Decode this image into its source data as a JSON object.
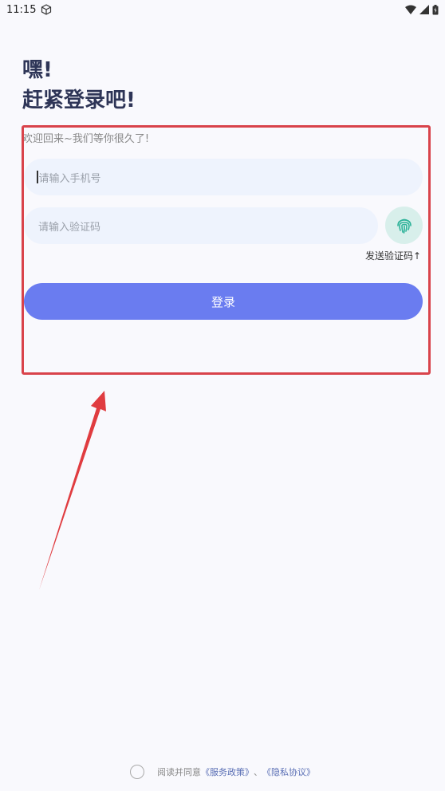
{
  "status_bar": {
    "time": "11:15"
  },
  "greeting": {
    "line1": "嘿!",
    "line2": "赶紧登录吧!"
  },
  "welcome_text": "欢迎回来~我们等你很久了!",
  "form": {
    "phone_placeholder": "请输入手机号",
    "code_placeholder": "请输入验证码",
    "send_code_label": "发送验证码↑",
    "login_label": "登录"
  },
  "agreement": {
    "prefix": "阅读并同意",
    "service_policy": "《服务政策》",
    "separator": "、",
    "privacy_policy": "《隐私协议》"
  },
  "colors": {
    "accent": "#6a7cf0",
    "highlight": "#d9434b",
    "title": "#2e3557",
    "fingerprint": "#2fb39a"
  },
  "icons": [
    "cube-icon",
    "wifi-icon",
    "signal-icon",
    "battery-icon",
    "fingerprint-icon",
    "red-arrow"
  ]
}
